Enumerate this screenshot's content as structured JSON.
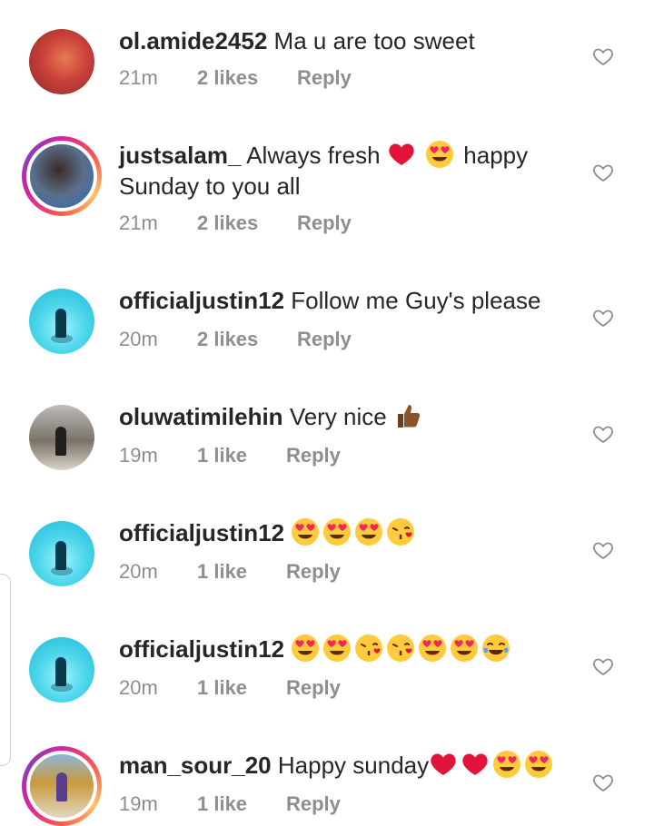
{
  "comments": [
    {
      "username": "ol.amide2452",
      "text": "Ma u are too sweet",
      "time": "21m",
      "likes": "2 likes",
      "reply": "Reply"
    },
    {
      "username": "justsalam_",
      "text_a": "Always fresh",
      "text_b": "happy",
      "text_c": "Sunday to you all",
      "time": "21m",
      "likes": "2 likes",
      "reply": "Reply"
    },
    {
      "username": "officialjustin12",
      "text": "Follow me Guy's please",
      "time": "20m",
      "likes": "2 likes",
      "reply": "Reply"
    },
    {
      "username": "oluwatimilehin",
      "text": "Very nice",
      "time": "19m",
      "likes": "1 like",
      "reply": "Reply"
    },
    {
      "username": "officialjustin12",
      "time": "20m",
      "likes": "1 like",
      "reply": "Reply"
    },
    {
      "username": "officialjustin12",
      "time": "20m",
      "likes": "1 like",
      "reply": "Reply"
    },
    {
      "username": "man_sour_20",
      "text": "Happy sunday",
      "time": "19m",
      "likes": "1 like",
      "reply": "Reply"
    }
  ],
  "colors": {
    "text": "#262626",
    "meta": "#8e8e8e",
    "heart": "#e4133a",
    "emoji_face": "#ffcb3d",
    "emoji_heart": "#f5245f"
  },
  "icons": {
    "like": "heart-outline-icon",
    "heart": "red-heart-emoji",
    "love_eyes": "heart-eyes-emoji",
    "kiss": "kissing-face-emoji",
    "laugh": "tears-of-joy-emoji",
    "thumb": "thumbs-up-emoji"
  }
}
